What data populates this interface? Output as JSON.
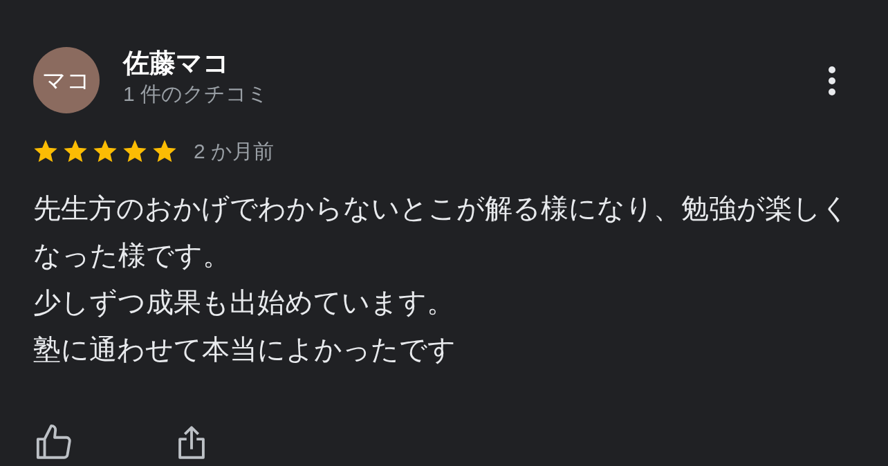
{
  "review": {
    "avatar": "マコ",
    "author": "佐藤マコ",
    "review_count": "1 件のクチコミ",
    "stars": 5,
    "time": "2 か月前",
    "body": [
      "先生方のおかげでわからないとこが解る様になり、勉強が楽しくなった様です。",
      "少しずつ成果も出始めています。",
      "塾に通わせて本当によかったです"
    ]
  }
}
